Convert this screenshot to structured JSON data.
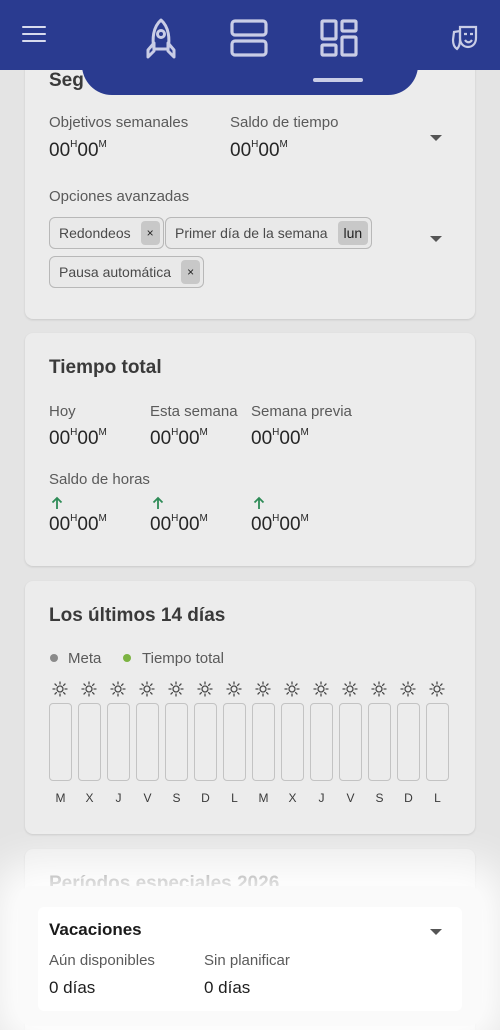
{
  "topbar": {
    "icons": [
      "menu-icon",
      "rocket-icon",
      "two-panels-icon",
      "dashboard-icon",
      "theater-masks-icon"
    ],
    "accent": "#2a3b90"
  },
  "settings_card": {
    "title_partial": "Seg",
    "weekly_goals_label": "Objetivos semanales",
    "weekly_goals_value": {
      "h": "00",
      "m": "00"
    },
    "time_balance_label": "Saldo de tiempo",
    "time_balance_value": {
      "h": "00",
      "m": "00"
    },
    "advanced_label": "Opciones avanzadas",
    "chips": {
      "rounding": "Redondeos",
      "rounding_x": "×",
      "first_day": "Primer día de la semana",
      "first_day_value": "lun",
      "auto_pause": "Pausa automática",
      "auto_pause_x": "×"
    }
  },
  "total_card": {
    "title": "Tiempo total",
    "today_label": "Hoy",
    "this_week_label": "Esta semana",
    "prev_week_label": "Semana previa",
    "balance_label": "Saldo de horas",
    "unit_h": "H",
    "unit_m": "M",
    "row1": [
      {
        "h": "00",
        "m": "00"
      },
      {
        "h": "00",
        "m": "00"
      },
      {
        "h": "00",
        "m": "00"
      }
    ],
    "row2": [
      {
        "h": "00",
        "m": "00"
      },
      {
        "h": "00",
        "m": "00"
      },
      {
        "h": "00",
        "m": "00"
      }
    ],
    "up_arrow_color": "#2e8b57"
  },
  "last14_card": {
    "title": "Los últimos 14 días",
    "legend_goal": "Meta",
    "legend_total": "Tiempo total",
    "legend_goal_color": "#8a8a8a",
    "legend_total_color": "#7cb342",
    "days": [
      "M",
      "X",
      "J",
      "V",
      "S",
      "D",
      "L",
      "M",
      "X",
      "J",
      "V",
      "S",
      "D",
      "L"
    ]
  },
  "special_card": {
    "title": "Períodos especiales 2026",
    "vacation": {
      "title": "Vacaciones",
      "available_label": "Aún disponibles",
      "available_value": "0 días",
      "unplanned_label": "Sin planificar",
      "unplanned_value": "0 días"
    }
  }
}
